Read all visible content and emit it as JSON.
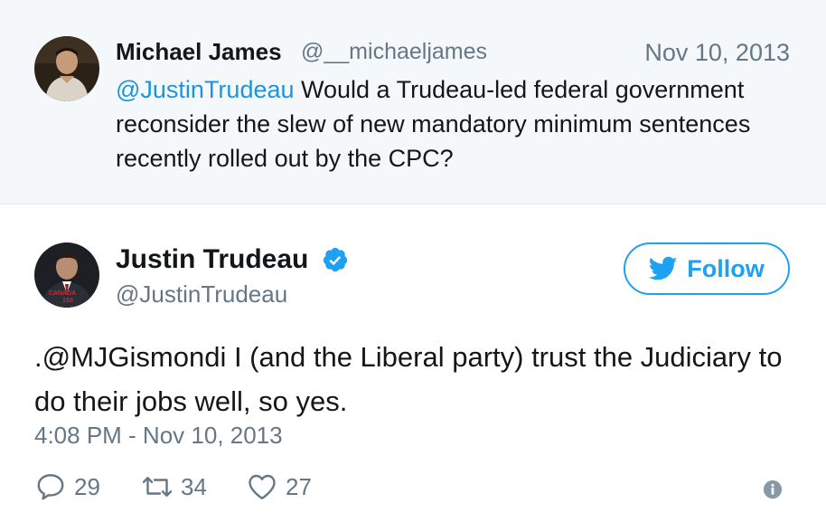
{
  "reply": {
    "author_name": "Michael James",
    "author_handle": "@__michaeljames",
    "date": "Nov 10, 2013",
    "mention": "@JustinTrudeau",
    "text": " Would a Trudeau-led federal government reconsider the slew of new mandatory minimum sentences recently rolled out by the CPC?"
  },
  "tweet": {
    "author_name": "Justin Trudeau",
    "author_handle": "@JustinTrudeau",
    "verified": true,
    "follow_label": "Follow",
    "text": ".@MJGismondi I (and the Liberal party) trust the Judiciary to do their jobs well, so yes.",
    "timestamp": "4:08 PM - Nov 10, 2013",
    "avatar_caption_line1": "CANADA",
    "avatar_caption_line2": "150"
  },
  "actions": {
    "replies": "29",
    "retweets": "34",
    "likes": "27",
    "reply_icon": "speech-bubble-icon",
    "retweet_icon": "retweet-icon",
    "like_icon": "heart-icon",
    "info_icon": "info-icon"
  },
  "colors": {
    "accent": "#1da1f2",
    "mention": "#1b95e0",
    "muted": "#657786",
    "reply_background": "#f5f8fa"
  }
}
